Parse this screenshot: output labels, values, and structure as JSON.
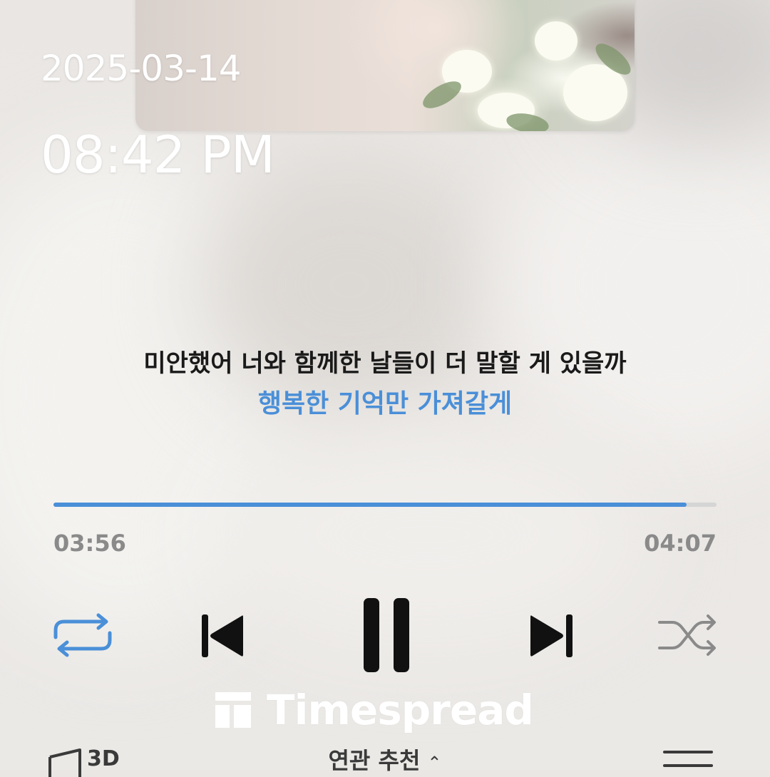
{
  "status": {
    "date": "2025-03-14",
    "time": "08:42 PM"
  },
  "lyrics": {
    "current": "미안했어 너와 함께한 날들이 더 말할 게 있을까",
    "next": "행복한 기억만 가져갈게"
  },
  "playback": {
    "elapsed": "03:56",
    "duration": "04:07",
    "progress_fraction": 0.955
  },
  "controls": {
    "repeat_icon": "repeat-icon",
    "previous_icon": "skip-previous-icon",
    "play_state_icon": "pause-icon",
    "next_icon": "skip-next-icon",
    "shuffle_icon": "shuffle-icon"
  },
  "watermark": {
    "text": "Timespread"
  },
  "bottom_bar": {
    "left_label": "3D",
    "center_label": "연관 추천",
    "center_chevron": "⌃"
  },
  "colors": {
    "accent": "#4a8fd8",
    "control": "#111111",
    "inactive": "#8a8a8a",
    "text": "#1a1a1a"
  }
}
